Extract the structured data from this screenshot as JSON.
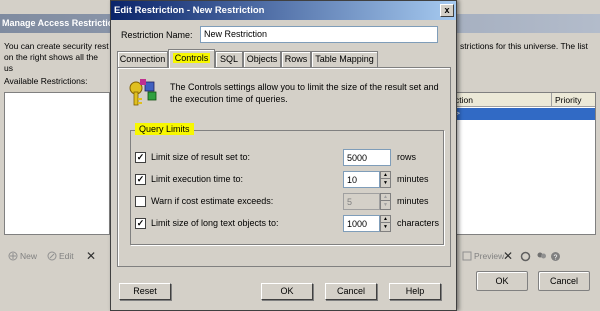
{
  "background_window": {
    "title": "Manage Access Restriction",
    "description_left": "You can create security rest\non the right shows all the us",
    "description_right": "strictions for this universe.  The list",
    "available_label": "Available Restrictions:",
    "list_columns": [
      "ction",
      "Priority"
    ],
    "selected_row_text": ">",
    "toolbar": {
      "new": "New",
      "edit": "Edit",
      "preview": "Preview"
    },
    "buttons": {
      "ok": "OK",
      "cancel": "Cancel"
    }
  },
  "dialog": {
    "title": "Edit Restriction - New Restriction",
    "close_glyph": "x",
    "restriction_name_label": "Restriction Name:",
    "restriction_name_value": "New Restriction",
    "tabs": [
      {
        "label": "Connection",
        "active": false
      },
      {
        "label": "Controls",
        "active": true
      },
      {
        "label": "SQL",
        "active": false
      },
      {
        "label": "Objects",
        "active": false
      },
      {
        "label": "Rows",
        "active": false
      },
      {
        "label": "Table Mapping",
        "active": false
      }
    ],
    "controls_description": "The Controls settings allow you to limit the size of the result set and the execution time of queries.",
    "query_limits": {
      "label": "Query Limits",
      "options": [
        {
          "label": "Limit size of result set to:",
          "checked": true,
          "value": "5000",
          "unit": "rows",
          "spinner": false,
          "enabled": true
        },
        {
          "label": "Limit execution time to:",
          "checked": true,
          "value": "10",
          "unit": "minutes",
          "spinner": true,
          "enabled": true
        },
        {
          "label": "Warn if cost estimate exceeds:",
          "checked": false,
          "value": "5",
          "unit": "minutes",
          "spinner": true,
          "enabled": false
        },
        {
          "label": "Limit size of long text objects to:",
          "checked": true,
          "value": "1000",
          "unit": "characters",
          "spinner": true,
          "enabled": true
        }
      ]
    },
    "buttons": {
      "reset": "Reset",
      "ok": "OK",
      "cancel": "Cancel",
      "help": "Help"
    }
  },
  "colors": {
    "highlight": "#f7f700",
    "title_active": "#0a246a",
    "title_inactive": "#7f8ba0",
    "selection": "#316ac5"
  }
}
